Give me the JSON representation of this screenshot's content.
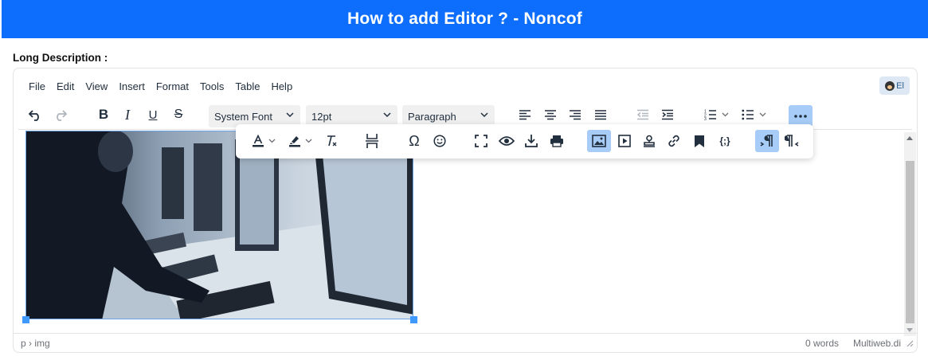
{
  "page": {
    "title": "How to add Editor ? - Noncof",
    "field_label": "Long Description :"
  },
  "editor": {
    "menu": [
      "File",
      "Edit",
      "View",
      "Insert",
      "Format",
      "Tools",
      "Table",
      "Help"
    ],
    "ai_button_label": "El",
    "toolbar": {
      "font_family": "System Font",
      "font_size": "12pt",
      "block_format": "Paragraph"
    },
    "icons": {
      "undo": "undo-icon",
      "redo": "redo-icon",
      "bold": "bold-icon",
      "italic": "italic-icon",
      "underline": "underline-icon",
      "strikethrough": "strikethrough-icon",
      "align_left": "align-left-icon",
      "align_center": "align-center-icon",
      "align_right": "align-right-icon",
      "justify": "justify-icon",
      "outdent": "outdent-icon",
      "indent": "indent-icon",
      "numbered_list": "numbered-list-icon",
      "bullet_list": "bullet-list-icon",
      "more": "more-icon"
    },
    "overflow_icons": [
      "text-color-icon",
      "highlight-color-icon",
      "clear-formatting-icon",
      "page-break-icon",
      "special-character-icon",
      "emoji-icon",
      "fullscreen-icon",
      "preview-icon",
      "save-icon",
      "print-icon",
      "image-icon",
      "media-icon",
      "template-icon",
      "link-icon",
      "anchor-icon",
      "code-sample-icon",
      "ltr-icon",
      "rtl-icon"
    ],
    "image_description": "office workers typing at computer monitors",
    "status": {
      "path": "p › img",
      "word_count": "0 words",
      "brand": "Multiweb.di"
    }
  },
  "colors": {
    "banner": "#0d6efd",
    "active_button": "#a6ccf7",
    "selection": "#4099ff"
  }
}
